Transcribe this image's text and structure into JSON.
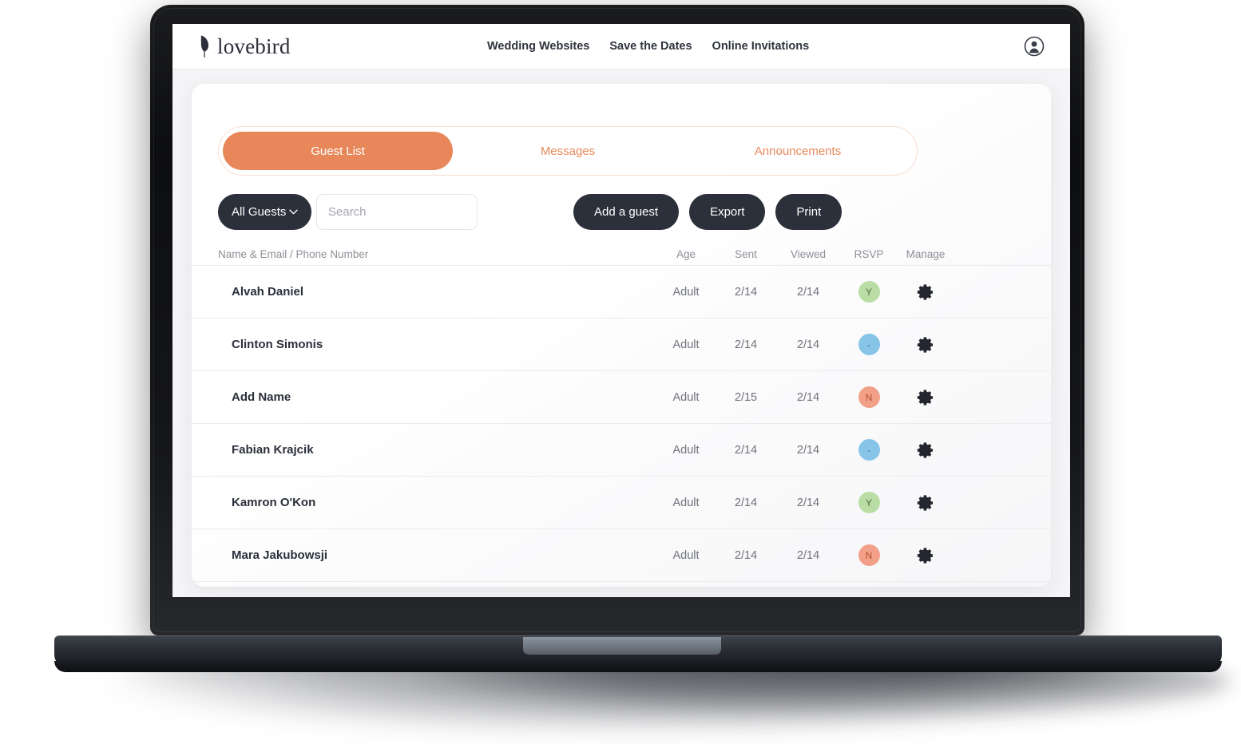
{
  "brand": {
    "name": "lovebird",
    "mark_icon": "feather-icon"
  },
  "nav": {
    "links": [
      {
        "label": "Wedding Websites"
      },
      {
        "label": "Save the Dates"
      },
      {
        "label": "Online Invitations"
      }
    ],
    "account_icon": "user-account-icon"
  },
  "tabs": [
    {
      "label": "Guest List",
      "active": true
    },
    {
      "label": "Messages",
      "active": false
    },
    {
      "label": "Announcements",
      "active": false
    }
  ],
  "toolbar": {
    "filter_label": "All Guests",
    "filter_icon": "chevron-down-icon",
    "search_placeholder": "Search",
    "search_value": "",
    "add_guest_label": "Add a guest",
    "export_label": "Export",
    "print_label": "Print"
  },
  "table": {
    "columns": [
      "Name & Email / Phone Number",
      "Age",
      "Sent",
      "Viewed",
      "RSVP",
      "Manage"
    ],
    "rows": [
      {
        "name": "Alvah Daniel",
        "age": "Adult",
        "sent": "2/14",
        "viewed": "2/14",
        "rsvp": "Y",
        "rsvp_state": "yes",
        "manage_icon": "gear-icon"
      },
      {
        "name": "Clinton Simonis",
        "age": "Adult",
        "sent": "2/14",
        "viewed": "2/14",
        "rsvp": "-",
        "rsvp_state": "pending",
        "manage_icon": "gear-icon"
      },
      {
        "name": "Add Name",
        "age": "Adult",
        "sent": "2/15",
        "viewed": "2/14",
        "rsvp": "N",
        "rsvp_state": "no",
        "manage_icon": "gear-icon"
      },
      {
        "name": "Fabian Krajcik",
        "age": "Adult",
        "sent": "2/14",
        "viewed": "2/14",
        "rsvp": "-",
        "rsvp_state": "pending",
        "manage_icon": "gear-icon"
      },
      {
        "name": "Kamron O'Kon",
        "age": "Adult",
        "sent": "2/14",
        "viewed": "2/14",
        "rsvp": "Y",
        "rsvp_state": "yes",
        "manage_icon": "gear-icon"
      },
      {
        "name": "Mara Jakubowsji",
        "age": "Adult",
        "sent": "2/14",
        "viewed": "2/14",
        "rsvp": "N",
        "rsvp_state": "no",
        "manage_icon": "gear-icon"
      }
    ]
  },
  "colors": {
    "accent": "#e8885a",
    "dark": "#2c303a",
    "rsvp_yes": "#b9dda4",
    "rsvp_no": "#f3a089",
    "rsvp_pending": "#87c5e8",
    "page_bg": "#f5f5f7"
  }
}
